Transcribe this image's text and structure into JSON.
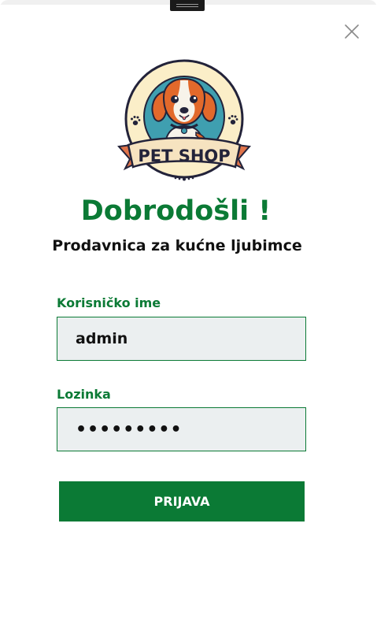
{
  "logo": {
    "text": "PET SHOP",
    "icon": "dog-icon",
    "colors": {
      "badge_bg": "#fbeec8",
      "circle_bg": "#3f9fb0",
      "outline": "#23233a",
      "ribbon": "#f6e3c0",
      "ribbon_shadow": "#e0744a",
      "dog_orange": "#e2692b"
    }
  },
  "welcome": {
    "title": "Dobrodošli !",
    "subtitle": "Prodavnica za kućne ljubimce"
  },
  "form": {
    "username_label": "Korisničko ime",
    "username_value": "admin",
    "password_label": "Lozinka",
    "password_value": "•••••••••",
    "submit_label": "PRIJAVA"
  },
  "icons": {
    "close": "close-icon",
    "drag": "drag-handle-icon"
  },
  "colors": {
    "accent": "#0b7a35",
    "field_bg": "#ebeff0",
    "text": "#111111"
  }
}
